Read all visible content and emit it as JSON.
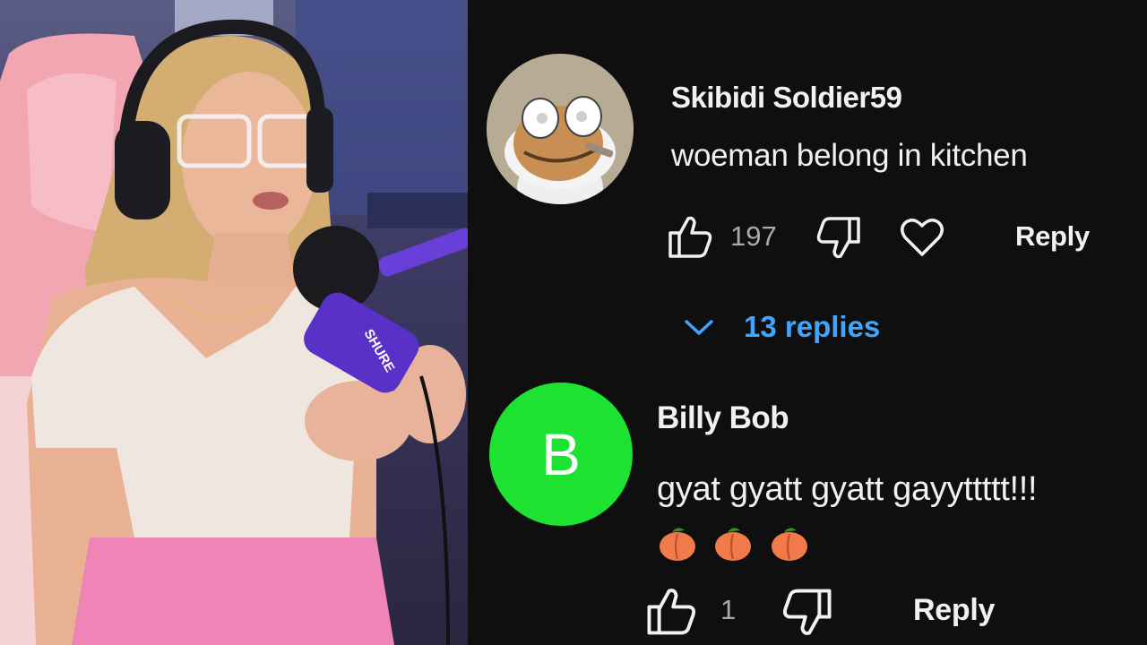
{
  "comments": [
    {
      "author": "Skibidi Soldier59",
      "text": "woeman belong in kitchen",
      "likes": "197",
      "reply_label": "Reply",
      "avatar_icon": "skibidi-toilet-avatar",
      "replies_label": "13 replies"
    },
    {
      "author": "Billy Bob",
      "avatar_letter": "B",
      "avatar_color": "#1ee231",
      "text": "gyat gyatt gyatt gayyttttt!!!",
      "emojis": [
        "peach",
        "peach",
        "peach"
      ],
      "likes": "1",
      "reply_label": "Reply"
    }
  ],
  "mic_brand": "SHURE",
  "colors": {
    "background": "#0f0f0f",
    "text": "#f1f1f1",
    "muted": "#aaaaaa",
    "link": "#3ea6ff"
  }
}
